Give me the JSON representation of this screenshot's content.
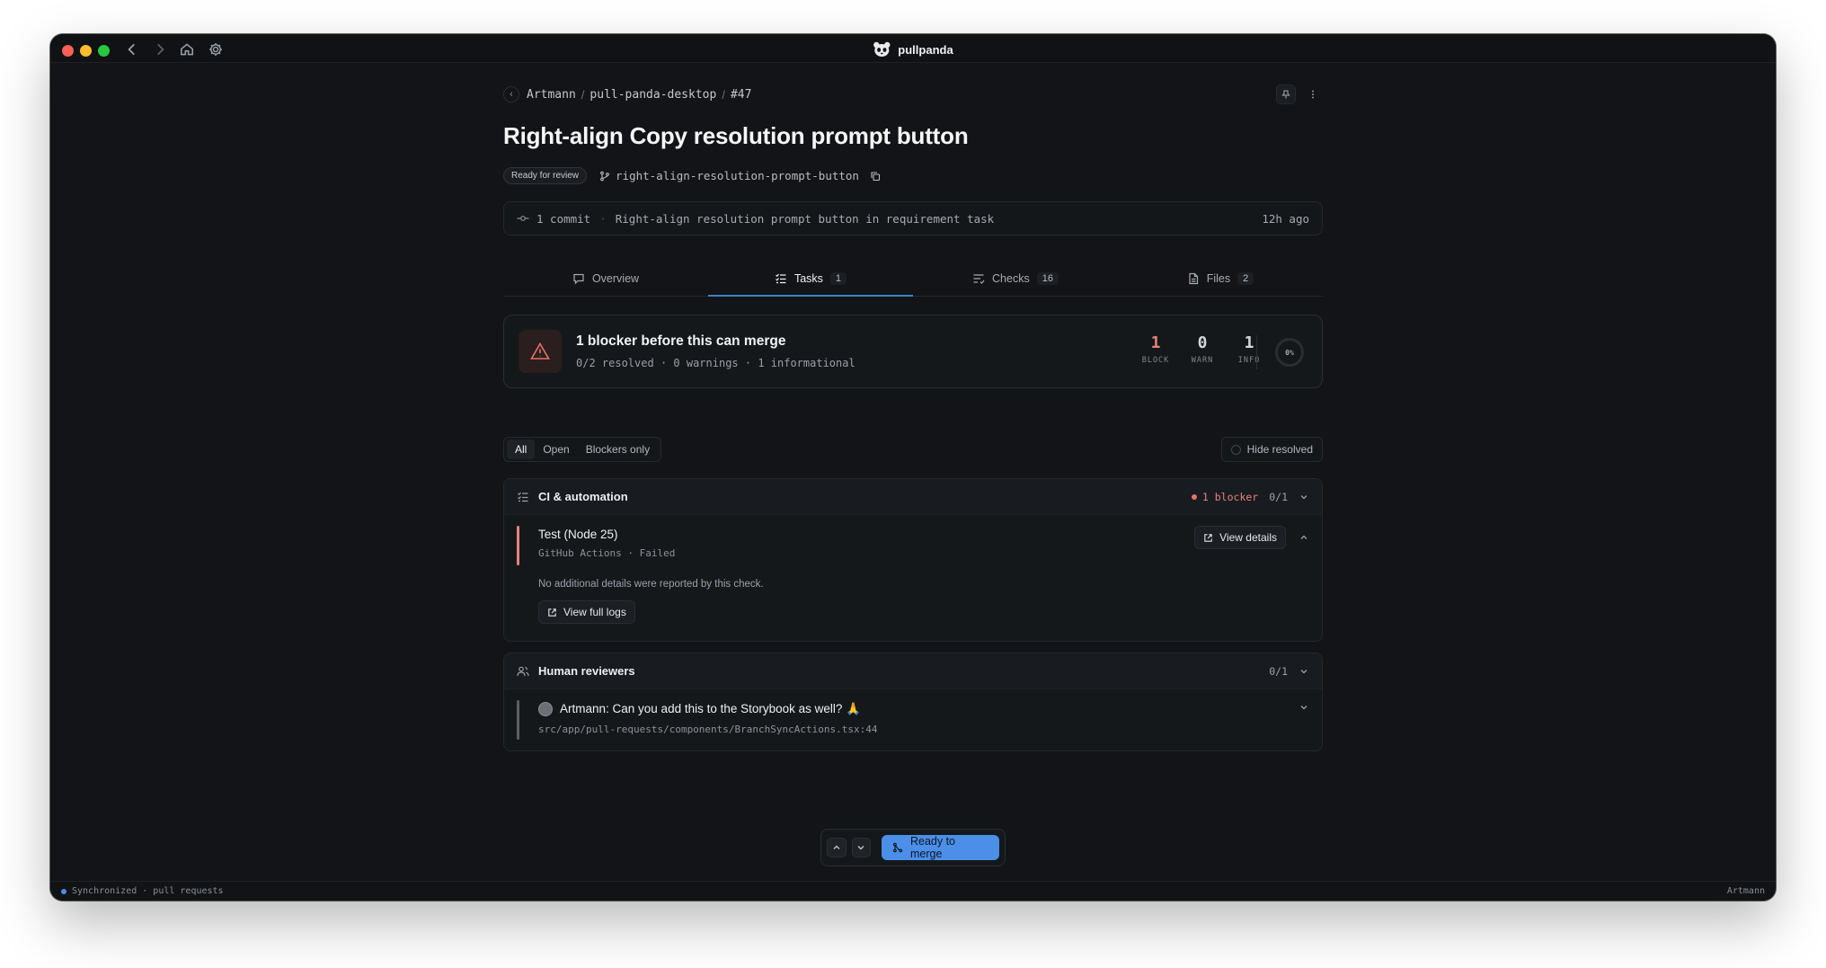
{
  "app": {
    "title": "pullpanda"
  },
  "breadcrumb": {
    "owner": "Artmann",
    "repo": "pull-panda-desktop",
    "number": "#47"
  },
  "pr": {
    "title": "Right-align Copy resolution prompt button",
    "status_badge": "Ready for review",
    "branch": "right-align-resolution-prompt-button"
  },
  "commit_bar": {
    "count": "1 commit",
    "message": "Right-align resolution prompt button in requirement task",
    "time_ago": "12h ago"
  },
  "tabs": [
    {
      "label": "Overview",
      "count": ""
    },
    {
      "label": "Tasks",
      "count": "1"
    },
    {
      "label": "Checks",
      "count": "16"
    },
    {
      "label": "Files",
      "count": "2"
    }
  ],
  "active_tab": "Tasks",
  "blocker_summary": {
    "title": "1 blocker before this can merge",
    "resolved": "0/2 resolved",
    "warnings": "0 warnings",
    "informational": "1 informational",
    "stats": [
      {
        "value": "1",
        "label": "BLOCK"
      },
      {
        "value": "0",
        "label": "WARN"
      },
      {
        "value": "1",
        "label": "INFO"
      }
    ],
    "progress": "0%"
  },
  "filters": {
    "all": "All",
    "open": "Open",
    "blockers": "Blockers only",
    "hide_resolved": "Hide resolved"
  },
  "sections": {
    "ci": {
      "title": "CI & automation",
      "blocker_label": "1 blocker",
      "count": "0/1",
      "item": {
        "title": "Test (Node 25)",
        "source": "GitHub Actions",
        "status": "Failed",
        "view_details": "View details",
        "detail_text": "No additional details were reported by this check.",
        "view_logs": "View full logs"
      }
    },
    "reviewers": {
      "title": "Human reviewers",
      "count": "0/1",
      "item": {
        "text": "Artmann: Can you add this to the Storybook as well? 🙏",
        "path": "src/app/pull-requests/components/BranchSyncActions.tsx:44"
      }
    }
  },
  "merge_bar": {
    "merge_label": "Ready to merge"
  },
  "status_bar": {
    "left": "Synchronized · pull requests",
    "right": "Artmann"
  },
  "colors": {
    "accent": "#4b8fe8",
    "blocker": "#e5726a",
    "background": "#121417"
  },
  "icons": [
    "panda-logo-icon",
    "chevron-left-icon",
    "chevron-right-icon",
    "home-icon",
    "gear-icon",
    "branch-icon",
    "copy-icon",
    "commit-icon",
    "chat-icon",
    "tasks-icon",
    "checks-icon",
    "file-icon",
    "warning-icon",
    "users-icon",
    "external-link-icon",
    "chevron-up-icon",
    "chevron-down-icon",
    "merge-icon"
  ]
}
